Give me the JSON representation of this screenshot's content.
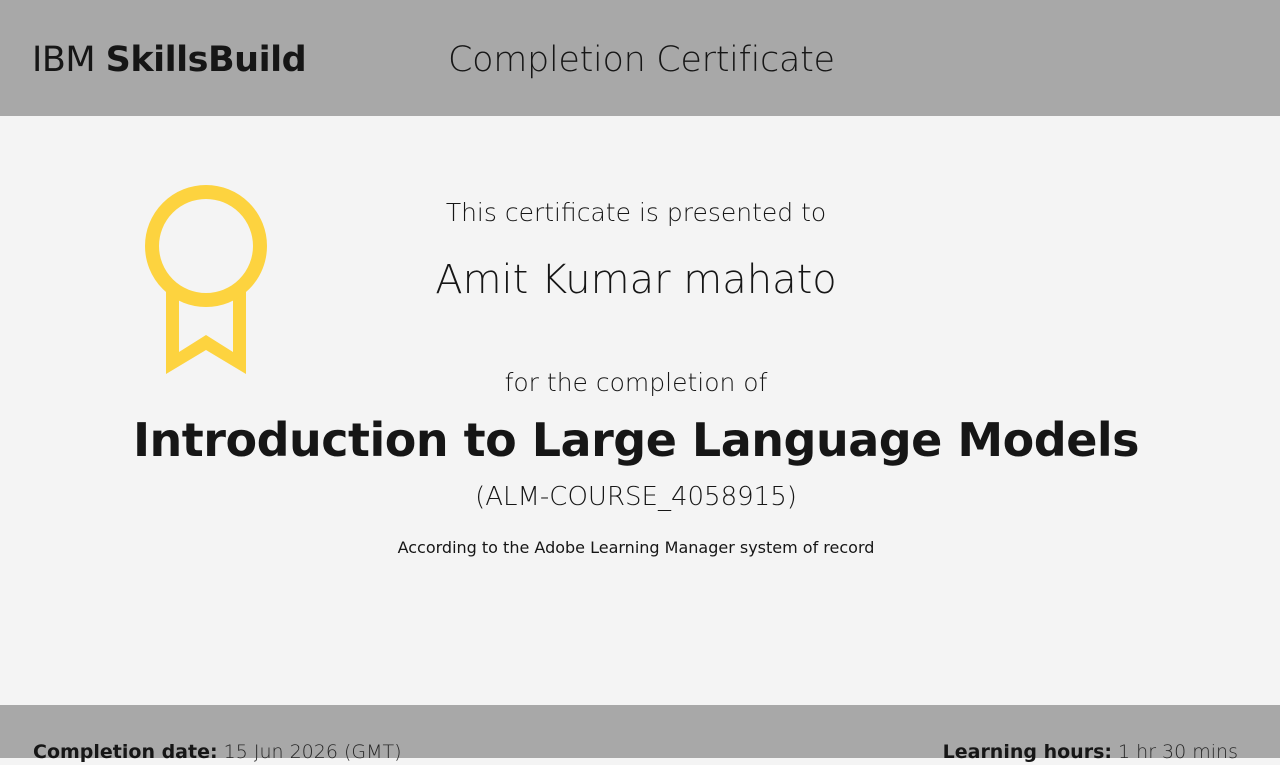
{
  "header": {
    "brand_prefix": "IBM",
    "brand_name": "SkillsBuild",
    "title": "Completion Certificate"
  },
  "certificate": {
    "presented_text": "This certificate is presented to",
    "recipient": "Amit Kumar mahato",
    "completion_text": "for the completion of",
    "course_title": "Introduction to Large Language Models",
    "course_code": "(ALM-COURSE_4058915)",
    "record_note": "According to the Adobe Learning Manager system of record"
  },
  "footer": {
    "completion_date_label": "Completion date:",
    "completion_date_value": "15 Jun 2026 (GMT)",
    "learning_hours_label": "Learning hours:",
    "learning_hours_value": "1 hr 30 mins"
  },
  "colors": {
    "header_bg": "#a8a8a8",
    "page_bg": "#f4f4f4",
    "badge": "#fdd33f"
  },
  "icons": {
    "badge": "award-ribbon-icon"
  }
}
